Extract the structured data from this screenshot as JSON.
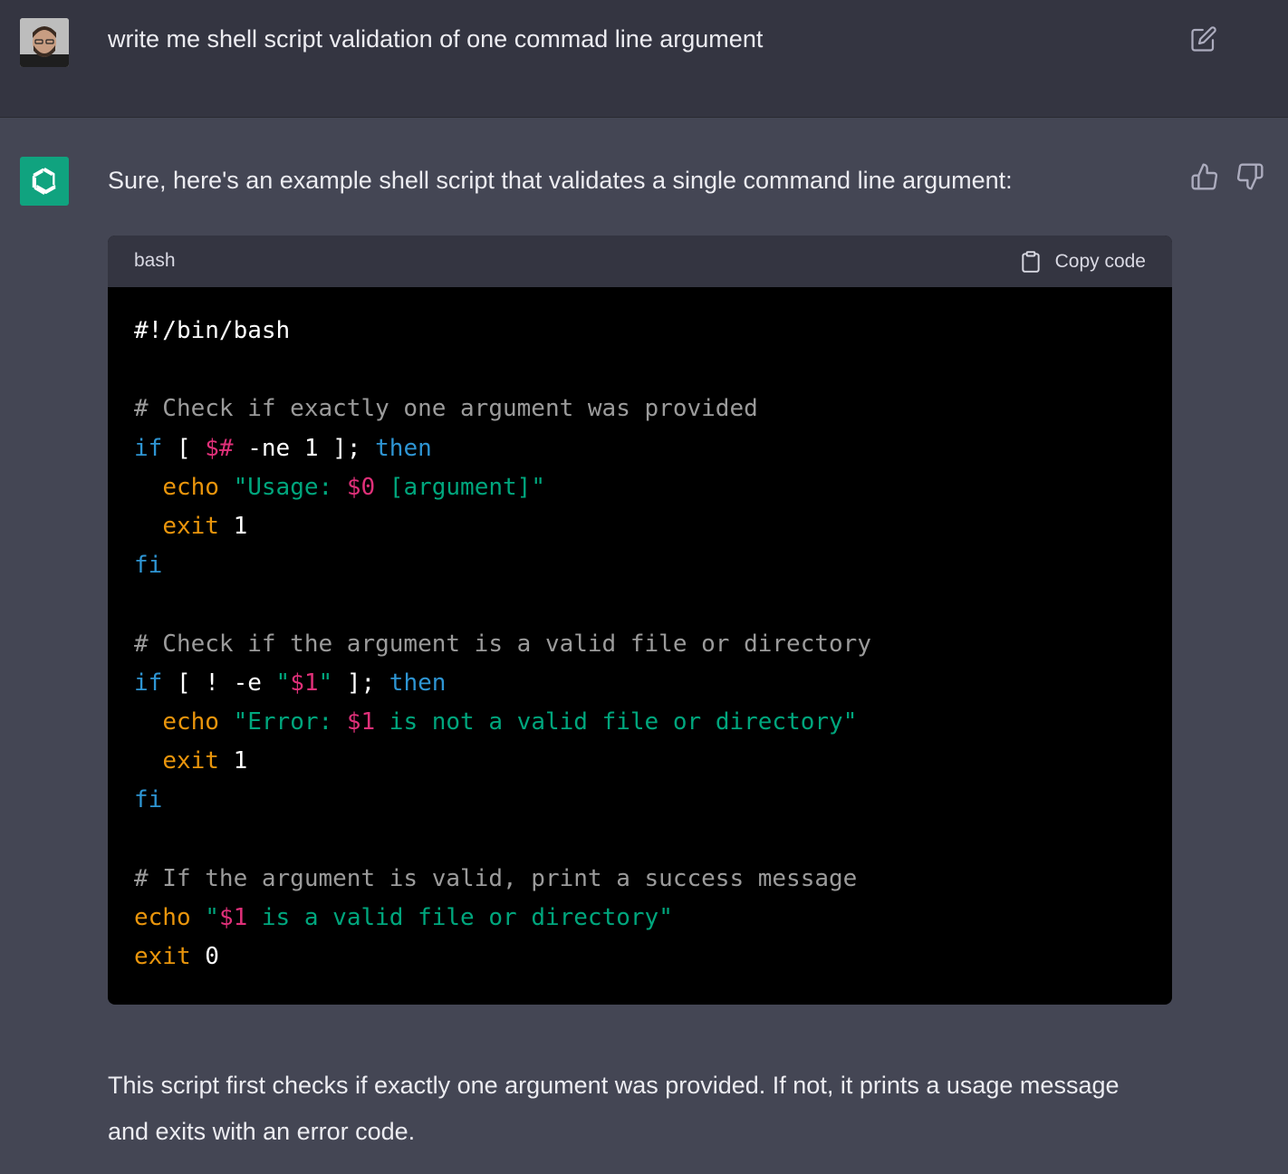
{
  "user_message": {
    "text": "write me shell script validation of one commad line argument",
    "avatar_icon": "user-avatar",
    "edit_icon": "edit-icon"
  },
  "assistant_message": {
    "avatar_icon": "openai-logo-icon",
    "intro": "Sure, here's an example shell script that validates a single command line argument:",
    "feedback": {
      "up_icon": "thumbs-up-icon",
      "down_icon": "thumbs-down-icon"
    },
    "code_block": {
      "language": "bash",
      "copy_label": "Copy code",
      "lines": [
        [
          {
            "t": "#!/bin/bash",
            "c": "plain"
          }
        ],
        [],
        [
          {
            "t": "# Check if exactly one argument was provided",
            "c": "comment"
          }
        ],
        [
          {
            "t": "if",
            "c": "kw"
          },
          {
            "t": " [ ",
            "c": "plain"
          },
          {
            "t": "$#",
            "c": "var"
          },
          {
            "t": " -ne 1 ]; ",
            "c": "plain"
          },
          {
            "t": "then",
            "c": "kw"
          }
        ],
        [
          {
            "t": "  ",
            "c": "plain"
          },
          {
            "t": "echo",
            "c": "builtin"
          },
          {
            "t": " \"Usage: ",
            "c": "str"
          },
          {
            "t": "$0",
            "c": "var"
          },
          {
            "t": " [argument]\"",
            "c": "str"
          }
        ],
        [
          {
            "t": "  ",
            "c": "plain"
          },
          {
            "t": "exit",
            "c": "builtin"
          },
          {
            "t": " 1",
            "c": "plain"
          }
        ],
        [
          {
            "t": "fi",
            "c": "kw"
          }
        ],
        [],
        [
          {
            "t": "# Check if the argument is a valid file or directory",
            "c": "comment"
          }
        ],
        [
          {
            "t": "if",
            "c": "kw"
          },
          {
            "t": " [ ! -e ",
            "c": "plain"
          },
          {
            "t": "\"",
            "c": "str"
          },
          {
            "t": "$1",
            "c": "var"
          },
          {
            "t": "\"",
            "c": "str"
          },
          {
            "t": " ]; ",
            "c": "plain"
          },
          {
            "t": "then",
            "c": "kw"
          }
        ],
        [
          {
            "t": "  ",
            "c": "plain"
          },
          {
            "t": "echo",
            "c": "builtin"
          },
          {
            "t": " \"Error: ",
            "c": "str"
          },
          {
            "t": "$1",
            "c": "var"
          },
          {
            "t": " is not a valid file or directory\"",
            "c": "str"
          }
        ],
        [
          {
            "t": "  ",
            "c": "plain"
          },
          {
            "t": "exit",
            "c": "builtin"
          },
          {
            "t": " 1",
            "c": "plain"
          }
        ],
        [
          {
            "t": "fi",
            "c": "kw"
          }
        ],
        [],
        [
          {
            "t": "# If the argument is valid, print a success message",
            "c": "comment"
          }
        ],
        [
          {
            "t": "echo",
            "c": "builtin"
          },
          {
            "t": " \"",
            "c": "str"
          },
          {
            "t": "$1",
            "c": "var"
          },
          {
            "t": " is a valid file or directory\"",
            "c": "str"
          }
        ],
        [
          {
            "t": "exit",
            "c": "builtin"
          },
          {
            "t": " 0",
            "c": "plain"
          }
        ]
      ]
    },
    "explanation": "This script first checks if exactly one argument was provided. If not, it prints a usage message and exits with an error code."
  },
  "colors": {
    "user_bg": "#343541",
    "assistant_bg": "#444654",
    "bot_avatar": "#10a37f",
    "code_bg": "#000000",
    "code_header_bg": "#343541",
    "keyword": "#2e95d3",
    "builtin": "#e9950c",
    "variable": "#df3079",
    "string": "#00a67d",
    "comment": "#9b9b9b"
  }
}
